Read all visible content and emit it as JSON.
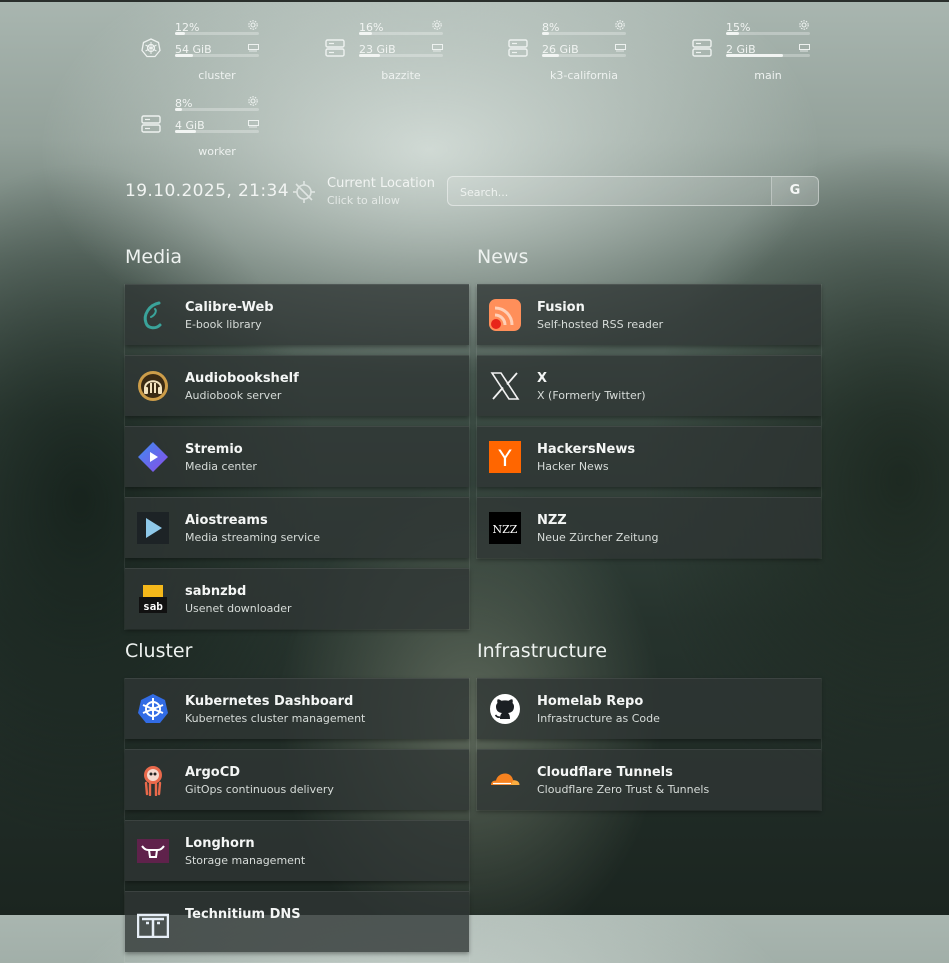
{
  "resources": [
    {
      "name": "cluster",
      "cpu": "12%",
      "cpu_frac": 0.12,
      "mem": "54 GiB",
      "mem_frac": 0.22,
      "icon": "kubernetes-icon"
    },
    {
      "name": "bazzite",
      "cpu": "16%",
      "cpu_frac": 0.16,
      "mem": "23 GiB",
      "mem_frac": 0.25,
      "icon": "server-icon"
    },
    {
      "name": "k3-california",
      "cpu": "8%",
      "cpu_frac": 0.08,
      "mem": "26 GiB",
      "mem_frac": 0.2,
      "icon": "server-icon"
    },
    {
      "name": "main",
      "cpu": "15%",
      "cpu_frac": 0.15,
      "mem": "2 GiB",
      "mem_frac": 0.68,
      "icon": "server-icon"
    },
    {
      "name": "worker",
      "cpu": "8%",
      "cpu_frac": 0.08,
      "mem": "4 GiB",
      "mem_frac": 0.25,
      "icon": "server-icon"
    }
  ],
  "datetime": "19.10.2025, 21:34",
  "location": {
    "title": "Current Location",
    "subtitle": "Click to allow"
  },
  "search": {
    "placeholder": "Search...",
    "provider_label": "G"
  },
  "groups": {
    "media": {
      "title": "Media",
      "services": [
        {
          "name": "Calibre-Web",
          "desc": "E-book library",
          "icon": "calibre-icon"
        },
        {
          "name": "Audiobookshelf",
          "desc": "Audiobook server",
          "icon": "audiobookshelf-icon"
        },
        {
          "name": "Stremio",
          "desc": "Media center",
          "icon": "stremio-icon"
        },
        {
          "name": "Aiostreams",
          "desc": "Media streaming service",
          "icon": "play-icon"
        },
        {
          "name": "sabnzbd",
          "desc": "Usenet downloader",
          "icon": "sabnzbd-icon"
        }
      ]
    },
    "news": {
      "title": "News",
      "services": [
        {
          "name": "Fusion",
          "desc": "Self-hosted RSS reader",
          "icon": "rss-icon"
        },
        {
          "name": "X",
          "desc": "X (Formerly Twitter)",
          "icon": "x-icon"
        },
        {
          "name": "HackersNews",
          "desc": "Hacker News",
          "icon": "hackernews-icon",
          "logo_text": "Y"
        },
        {
          "name": "NZZ",
          "desc": "Neue Zürcher Zeitung",
          "icon": "nzz-icon",
          "logo_text": "NZZ"
        }
      ]
    },
    "cluster": {
      "title": "Cluster",
      "services": [
        {
          "name": "Kubernetes Dashboard",
          "desc": "Kubernetes cluster management",
          "icon": "kubernetes-icon"
        },
        {
          "name": "ArgoCD",
          "desc": "GitOps continuous delivery",
          "icon": "argocd-icon"
        },
        {
          "name": "Longhorn",
          "desc": "Storage management",
          "icon": "longhorn-icon"
        },
        {
          "name": "Technitium DNS",
          "desc": "",
          "icon": "technitium-icon"
        }
      ]
    },
    "infrastructure": {
      "title": "Infrastructure",
      "services": [
        {
          "name": "Homelab Repo",
          "desc": "Infrastructure as Code",
          "icon": "github-icon"
        },
        {
          "name": "Cloudflare Tunnels",
          "desc": "Cloudflare Zero Trust & Tunnels",
          "icon": "cloudflare-icon"
        }
      ]
    }
  },
  "colors": {
    "accent_calibre": "#3aa39a",
    "stremio": "#7b5bf0",
    "hackernews": "#ff6600",
    "fusion": "#ff7a3c",
    "cloudflare": "#f6821f",
    "longhorn": "#5f224b",
    "kubernetes": "#326ce5"
  }
}
